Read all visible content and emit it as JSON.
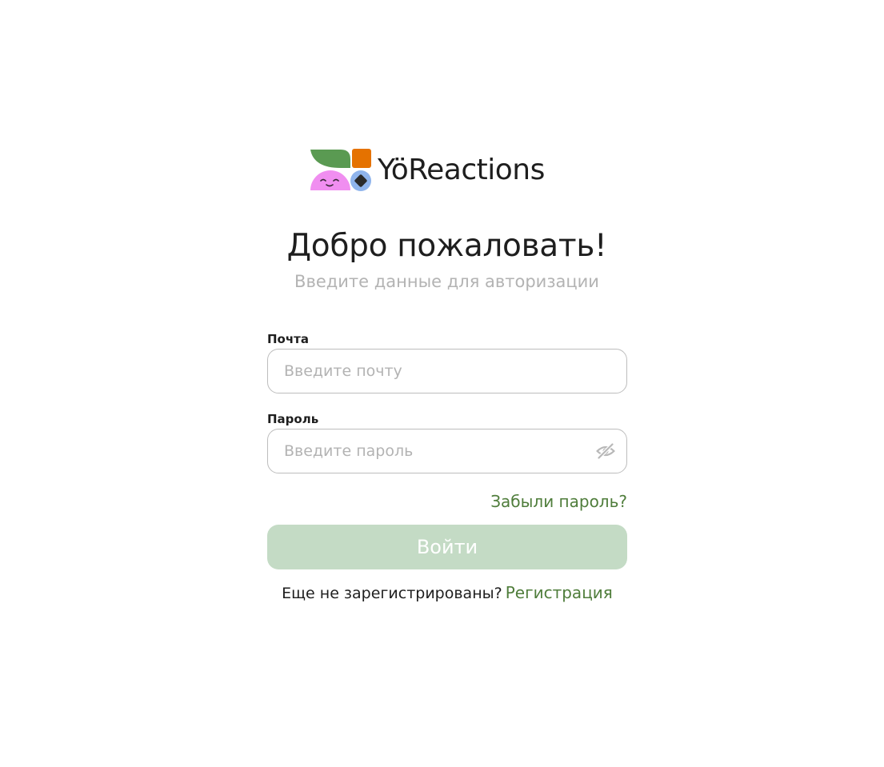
{
  "brand": {
    "name": "YöReactions",
    "colors": {
      "leaf": "#5a9a52",
      "square": "#e57200",
      "face": "#f08ef0",
      "circle": "#8fb4ec",
      "diamond": "#2a2a2a"
    }
  },
  "header": {
    "title": "Добро пожаловать!",
    "subtitle": "Введите данные для авторизации"
  },
  "form": {
    "email": {
      "label": "Почта",
      "value": "",
      "placeholder": "Введите почту"
    },
    "password": {
      "label": "Пароль",
      "value": "",
      "placeholder": "Введите пароль",
      "toggle_icon": "eye-off-icon"
    },
    "forgot_label": "Забыли пароль?",
    "submit_label": "Войти",
    "register_prompt": "Еще не зарегистрированы?",
    "register_label": "Регистрация"
  },
  "theme": {
    "accent": "#4f7d3b",
    "button_disabled": "#c4dbc5",
    "placeholder": "#b3b3b3",
    "text": "#1e1e1e"
  }
}
